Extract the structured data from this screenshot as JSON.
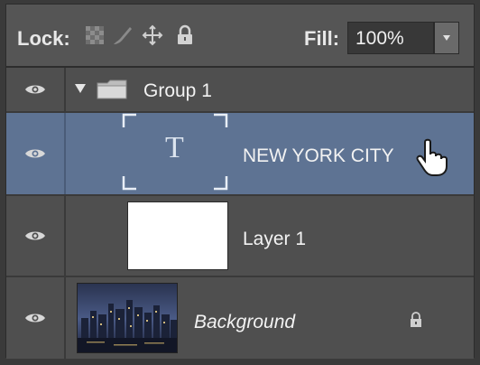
{
  "toolbar": {
    "lock_label": "Lock:",
    "fill_label": "Fill:",
    "fill_value": "100%"
  },
  "layers": [
    {
      "name": "Group 1",
      "type": "group",
      "visible": true
    },
    {
      "name": "NEW YORK CITY",
      "type": "text",
      "visible": true,
      "selected": true,
      "thumb_glyph": "T"
    },
    {
      "name": "Layer 1",
      "type": "pixel",
      "visible": true
    },
    {
      "name": "Background",
      "type": "background",
      "visible": true,
      "locked": true
    }
  ],
  "colors": {
    "panel_bg": "#4f4f4f",
    "selected_row": "#5e7393",
    "text": "#f2f2f2"
  }
}
